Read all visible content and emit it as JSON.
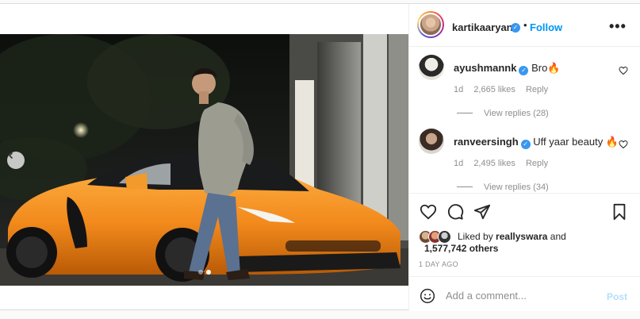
{
  "post": {
    "author": "kartikaaryan",
    "follow_label": "Follow",
    "separator": "•",
    "more_label": "•••",
    "media": {
      "current_slide": 2,
      "total_slides": 2
    }
  },
  "comments": [
    {
      "username": "ayushmannk",
      "text": "Bro🔥",
      "time": "1d",
      "likes": "2,665 likes",
      "reply_label": "Reply",
      "view_replies": "View replies (28)"
    },
    {
      "username": "ranveersingh",
      "text": "Uff yaar beauty 🔥",
      "time": "1d",
      "likes": "2,495 likes",
      "reply_label": "Reply",
      "view_replies": "View replies (34)"
    }
  ],
  "likes": {
    "liked_by_prefix": "Liked by",
    "liked_by_user": "reallyswara",
    "and_label": "and",
    "others": "1,577,742 others"
  },
  "timestamp": "1 DAY AGO",
  "comment_box": {
    "placeholder": "Add a comment...",
    "post_label": "Post"
  },
  "colors": {
    "accent": "#0095f6",
    "verified": "#3897f0",
    "car": "#f28a1c"
  },
  "icons": [
    "chevron-left-icon",
    "heart-icon",
    "comment-icon",
    "share-icon",
    "bookmark-icon",
    "emoji-icon",
    "verified-icon"
  ]
}
